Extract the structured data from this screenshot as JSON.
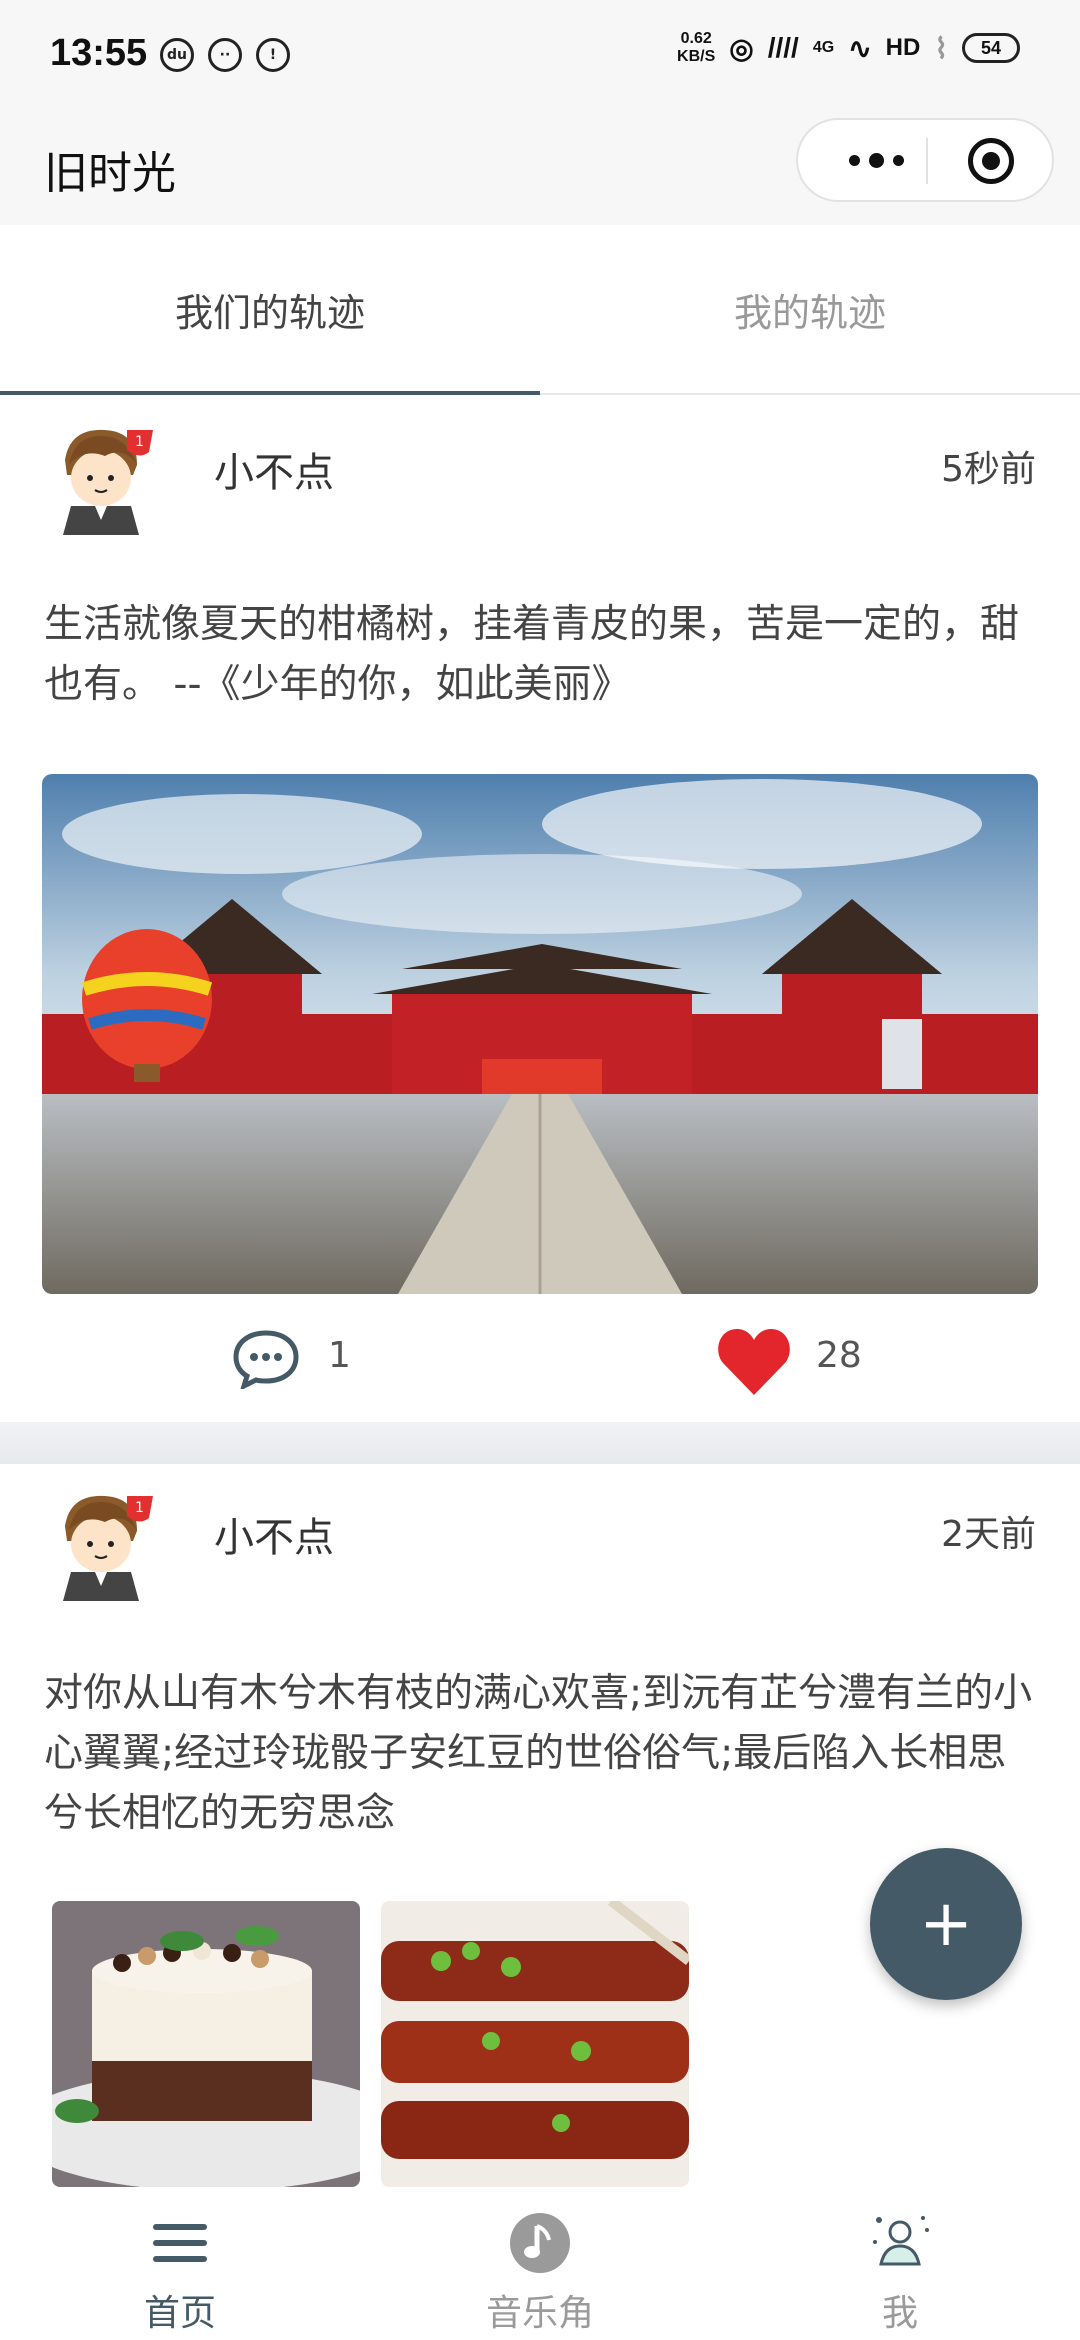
{
  "status_bar": {
    "time": "13:55",
    "net_speed_value": "0.62",
    "net_speed_unit": "KB/S",
    "network": "4G",
    "hd": "HD",
    "battery": "54"
  },
  "nav": {
    "title": "旧时光"
  },
  "tabs": [
    {
      "label": "我们的轨迹",
      "active": true
    },
    {
      "label": "我的轨迹",
      "active": false
    }
  ],
  "posts": [
    {
      "username": "小不点",
      "time_ago": "5秒前",
      "text": "生活就像夏天的柑橘树，挂着青皮的果，苦是一定的，甜也有。 --《少年的你，如此美丽》",
      "comment_count": "1",
      "like_count": "28"
    },
    {
      "username": "小不点",
      "time_ago": "2天前",
      "text": "对你从山有木兮木有枝的满心欢喜;到沅有芷兮澧有兰的小心翼翼;经过玲珑骰子安红豆的世俗俗气;最后陷入长相思兮长相忆的无穷思念"
    }
  ],
  "fab": {
    "label": "+"
  },
  "tabbar": [
    {
      "label": "首页",
      "icon": "menu-icon"
    },
    {
      "label": "音乐角",
      "icon": "music-note-icon"
    },
    {
      "label": "我",
      "icon": "person-icon"
    }
  ],
  "colors": {
    "accent": "#445a66",
    "heart": "#e3262c",
    "inactive": "#9a9a9a"
  }
}
